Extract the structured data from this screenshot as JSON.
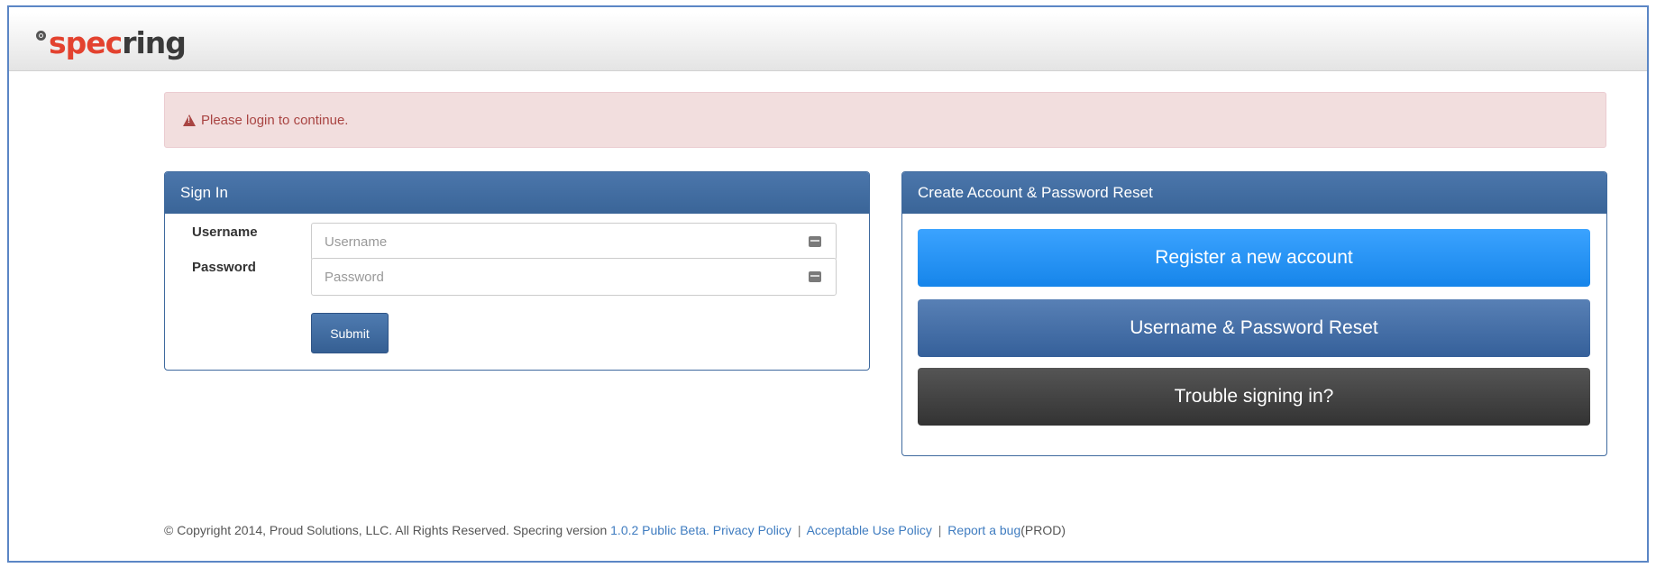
{
  "brand": {
    "logo_part1": "spec",
    "logo_part2": "ring"
  },
  "alert": {
    "icon": "warning-icon",
    "text": "Please login to continue."
  },
  "signin": {
    "title": "Sign In",
    "username_label": "Username",
    "username_placeholder": "Username",
    "username_value": "",
    "password_label": "Password",
    "password_placeholder": "Password",
    "password_value": "",
    "submit_label": "Submit"
  },
  "create": {
    "title": "Create Account & Password Reset",
    "register_label": "Register a new account",
    "reset_label": "Username & Password Reset",
    "trouble_label": "Trouble signing in?"
  },
  "footer": {
    "copyright": "© Copyright 2014, Proud Solutions, LLC. All Rights Reserved. Specring version",
    "version_link": "1.0.2 Public Beta.",
    "privacy_link": "Privacy Policy",
    "separator": "|",
    "aup_link": "Acceptable Use Policy",
    "bug_link": "Report a bug",
    "env": "(PROD)"
  },
  "colors": {
    "accent": "#3a6598",
    "alert_bg": "#f2dede",
    "alert_text": "#a94442",
    "register_blue": "#1685ea",
    "link": "#3f7cc0"
  }
}
